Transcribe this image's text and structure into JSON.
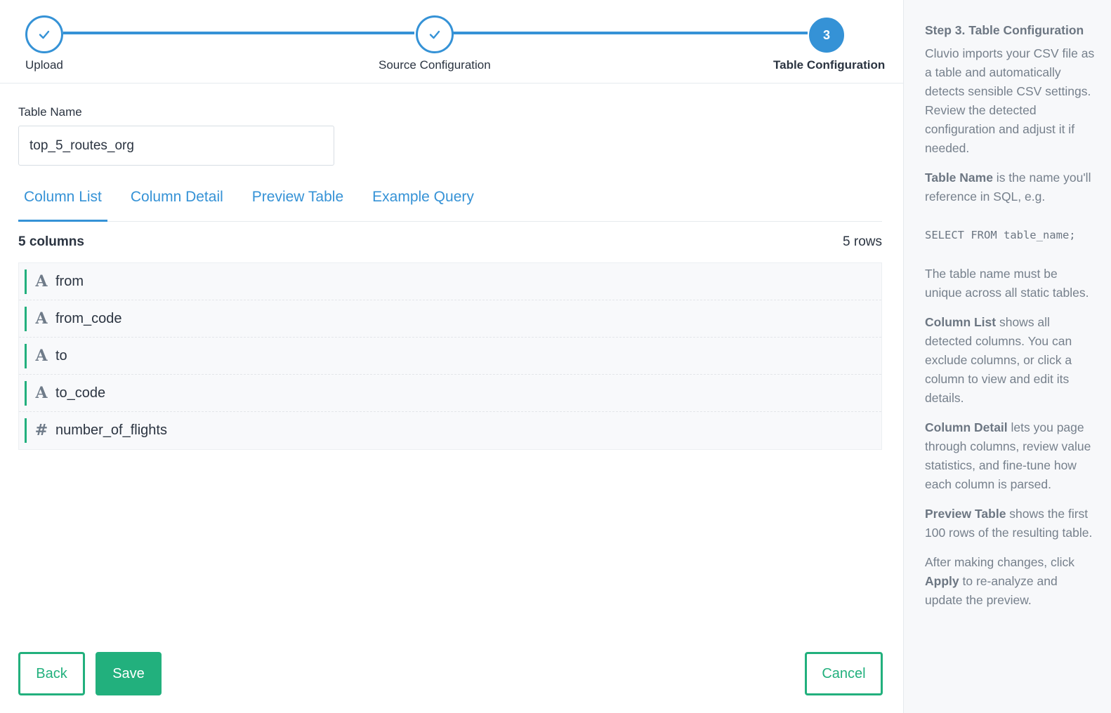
{
  "stepper": {
    "steps": [
      {
        "label": "Upload",
        "state": "done"
      },
      {
        "label": "Source Configuration",
        "state": "done"
      },
      {
        "label": "Table Configuration",
        "state": "active",
        "number": "3"
      }
    ]
  },
  "form": {
    "table_name_label": "Table Name",
    "table_name_value": "top_5_routes_org"
  },
  "tabs": [
    {
      "label": "Column List",
      "active": true
    },
    {
      "label": "Column Detail",
      "active": false
    },
    {
      "label": "Preview Table",
      "active": false
    },
    {
      "label": "Example Query",
      "active": false
    }
  ],
  "columns_summary": {
    "columns_count": "5 columns",
    "rows_count": "5 rows"
  },
  "columns": [
    {
      "type_icon": "text-type-icon",
      "type_glyph": "A",
      "name": "from"
    },
    {
      "type_icon": "text-type-icon",
      "type_glyph": "A",
      "name": "from_code"
    },
    {
      "type_icon": "text-type-icon",
      "type_glyph": "A",
      "name": "to"
    },
    {
      "type_icon": "text-type-icon",
      "type_glyph": "A",
      "name": "to_code"
    },
    {
      "type_icon": "number-type-icon",
      "type_glyph": "#",
      "name": "number_of_flights"
    }
  ],
  "buttons": {
    "back": "Back",
    "save": "Save",
    "cancel": "Cancel"
  },
  "help": {
    "heading": "Step 3. Table Configuration",
    "intro": "Cluvio imports your CSV file as a table and automatically detects sensible CSV settings. Review the detected configuration and adjust it if needed.",
    "table_name_term": "Table Name",
    "table_name_text": " is the name you'll reference in SQL, e.g.",
    "sql_example": "SELECT FROM table_name;",
    "unique_text": "The table name must be unique across all static tables.",
    "column_list_term": "Column List",
    "column_list_text": " shows all detected columns. You can exclude columns, or click a column to view and edit its details.",
    "column_detail_term": "Column Detail",
    "column_detail_text": " lets you page through columns, review value statistics, and fine-tune how each column is parsed.",
    "preview_table_term": "Preview Table",
    "preview_table_text": " shows the first 100 rows of the resulting table.",
    "apply_pre": "After making changes, click ",
    "apply_term": "Apply",
    "apply_post": " to re-analyze and update the preview."
  },
  "colors": {
    "primary_blue": "#3592d6",
    "success_green": "#22b07d",
    "text_dark": "#2b3441",
    "text_muted": "#76808c"
  }
}
